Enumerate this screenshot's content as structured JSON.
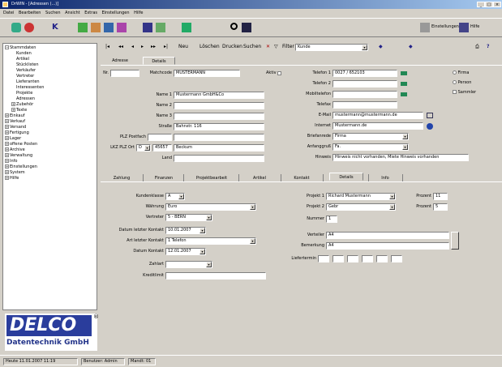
{
  "window": {
    "title": "DrWIN - [Adressen (...)]",
    "min": "_",
    "max": "□",
    "close": "×"
  },
  "menu": [
    "Datei",
    "Bearbeiten",
    "Suchen",
    "Ansicht",
    "Extras",
    "Einstellungen",
    "Hilfe"
  ],
  "toolbar": {
    "btn1": "Einstellungen",
    "btn2": "Hilfe"
  },
  "tree": {
    "items": [
      "Stammdaten",
      "Kunden",
      "Artikel",
      "Stücklisten",
      "Verkäufer",
      "Vertreter",
      "Lieferanten",
      "Interessenten",
      "Projekte",
      "Adressen",
      "Zubehör",
      "Texte",
      "Einkauf",
      "Verkauf",
      "Versand",
      "Fertigung",
      "Lager",
      "offene Posten",
      "Archive",
      "Verwaltung",
      "Info",
      "Einstellungen",
      "System",
      "Hilfe"
    ]
  },
  "logo": {
    "line1": "DELCO",
    "reg": "®",
    "line2": "Datentechnik GmbH"
  },
  "status": {
    "date": "Heute 11.01.2007 11:19",
    "user": "Benutzer: Admin",
    "version": "Mandt: 01"
  },
  "nav": {
    "neu": "Neu",
    "loeschen": "Löschen",
    "drucken": "Drucken",
    "suchen": "Suchen",
    "filter": "Filter",
    "filter_value": "Kunde"
  },
  "tabs_top": [
    "Adresse",
    "Details"
  ],
  "form": {
    "nr_label": "Nr.",
    "nr_value": "",
    "matchcode_label": "Matchcode",
    "matchcode_value": "MUSTERMANN",
    "aktiv_label": "Aktiv",
    "name1_label": "Name 1",
    "name1_value": "Mustermann GmbH&Co",
    "name2_label": "Name 2",
    "name2_value": "",
    "name3_label": "Name 3",
    "name3_value": "",
    "strasse_label": "Straße",
    "strasse_value": "Bahnstr. 116",
    "plz_fach_label": "PLZ Postfach",
    "plz_fach_value": "",
    "lkz_plz_label": "LKZ PLZ Ort",
    "lkz_value": "D",
    "plz_value": "45657",
    "ort_value": "Beckum",
    "land_label": "Land",
    "land_value": "",
    "tel1_label": "Telefon 1",
    "tel1_value": "0027 / 652103",
    "tel2_label": "Telefon 2",
    "tel2_value": "",
    "mobil_label": "Mobiltelefon",
    "mobil_value": "",
    "telefax_label": "Telefax",
    "telefax_value": "",
    "email_label": "E-Mail",
    "email_value": "mustermann@mustermann.de",
    "internet_label": "Internet",
    "internet_value": "Mustermann.de",
    "anrede_label": "Briefanrede",
    "anrede_value": "Firma",
    "brief_label": "Anfanggruß",
    "brief_value": "Fa.",
    "hinweis_label": "Hinweis",
    "hinweis_value": "Hinweis nicht vorhanden, Miete Hinweis vorhanden",
    "radio1": "Firma",
    "radio2": "Person",
    "check1": "Sammler"
  },
  "tabs_mid": [
    "Zahlung",
    "Finanzen",
    "Projektbearbeit",
    "Artikel",
    "Kontakt",
    "Details",
    "Info"
  ],
  "details": {
    "kundenklasse_label": "Kundenklasse",
    "kundenklasse_value": "A",
    "waehrung_label": "Währung",
    "waehrung_value": "Euro",
    "vertreter_label": "Vertreter",
    "vertreter_value": "5 - BERN",
    "letzte_kontakt_label": "Datum letzter Kontakt",
    "letzte_kontakt_value": "10.01.2007",
    "art_kontakt_label": "Art letzter Kontakt",
    "art_kontakt_value": "1 Telefon",
    "naechster_label": "Datum Kontakt",
    "naechster_value": "12.01.2007",
    "zahlart_label": "Zahlart",
    "zahlart_value": "",
    "kredit_label": "Kreditlimit",
    "kredit_value": "",
    "projekt1_label": "Projekt 1",
    "projekt1_value": "Richard Mustermann",
    "projekt2_label": "Projekt 2",
    "projekt2_value": "Gebr",
    "prozent1_label": "Prozent",
    "prozent1_value": "11",
    "prozent2_label": "Prozent",
    "prozent2_value": "5",
    "nummer_label": "Nummer",
    "nummer_value": "1",
    "verteiler_label": "Verteiler",
    "verteiler_value": "A4",
    "bemerkung_label": "Bemerkung",
    "bemerkung_value": "A4",
    "liefertermin_label": "Liefertermin",
    "liefertermin_values": [
      "",
      "",
      "",
      "",
      "",
      ""
    ]
  }
}
